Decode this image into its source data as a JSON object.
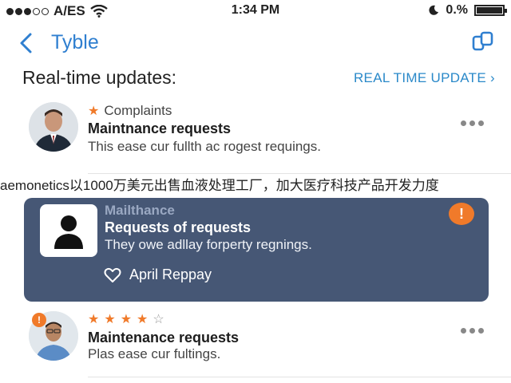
{
  "status": {
    "carrier": "A/ES",
    "time": "1:34 PM",
    "battery": "0.%",
    "signal_filled": 3,
    "signal_total": 5
  },
  "nav": {
    "title": "Tyble"
  },
  "section": {
    "title": "Real-time updates:",
    "link": "REAL TIME UPDATE ›"
  },
  "items": [
    {
      "category": "Complaints",
      "title": "Maintnance requests",
      "desc": "This ease cur fullth ac rogest requings."
    },
    {
      "title": "Maintenance requests",
      "desc": "Plas ease cur fultings.",
      "rating": 4,
      "rating_max": 5,
      "alert": "!"
    }
  ],
  "banner": "aemonetics以1000万美元出售血液处理工厂，加大医疗科技产品开发力度",
  "card": {
    "sender": "Mailthance",
    "title": "Requests of requests",
    "desc": "They owe adllay forperty regnings.",
    "reply": "April Reppay",
    "badge": "!"
  },
  "colors": {
    "accent": "#2f7fd0",
    "card_bg": "#465775",
    "badge": "#f07a2a"
  }
}
